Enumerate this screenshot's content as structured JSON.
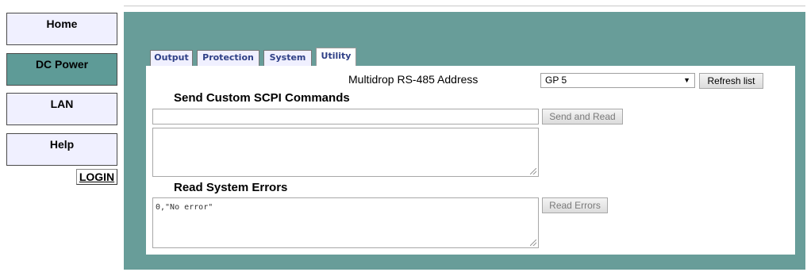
{
  "nav": {
    "home": "Home",
    "dc_power": "DC Power",
    "lan": "LAN",
    "help": "Help",
    "login": "LOGIN"
  },
  "tabs": {
    "output": "Output",
    "protection": "Protection",
    "system": "System",
    "utility": "Utility"
  },
  "utility": {
    "multidrop_label": "Multidrop RS-485 Address",
    "multidrop_selected": "GP 5",
    "refresh_label": "Refresh list",
    "scpi_title": "Send Custom SCPI Commands",
    "scpi_command_value": "",
    "scpi_response_value": "",
    "send_read_label": "Send and Read",
    "errors_title": "Read System Errors",
    "errors_value": "0,\"No error\"",
    "read_errors_label": "Read Errors"
  },
  "colors": {
    "teal_panel": "#689d99",
    "nav_active": "#5e9b97",
    "nav_bg": "#f0f0ff",
    "tab_text": "#2e3f86"
  }
}
